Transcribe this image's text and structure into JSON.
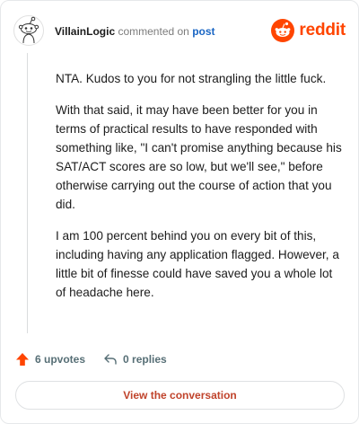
{
  "header": {
    "username": "VillainLogic",
    "commented_on": "commented on",
    "post_link": "post",
    "brand_name": "reddit"
  },
  "comment": {
    "paragraphs": [
      "NTA. Kudos to you for not strangling the little fuck.",
      "With that said, it may have been better for you in terms of practical results to have responded with something like, \"I can't promise anything because his SAT/ACT scores are so low, but we'll see,\" before otherwise carrying out the course of action that you did.",
      "I am 100 percent behind you on every bit of this, including having any application flagged. However, a little bit of finesse could have saved you a whole lot of headache here."
    ]
  },
  "actions": {
    "upvotes_label": "6 upvotes",
    "replies_label": "0 replies",
    "upvote_icon": "arrow-up-icon",
    "reply_icon": "reply-arrow-icon"
  },
  "cta": {
    "label": "View the conversation"
  },
  "colors": {
    "brand": "#ff4500",
    "link": "#1a66c4",
    "cta_text": "#c0432b",
    "meta_text": "#576f76"
  }
}
